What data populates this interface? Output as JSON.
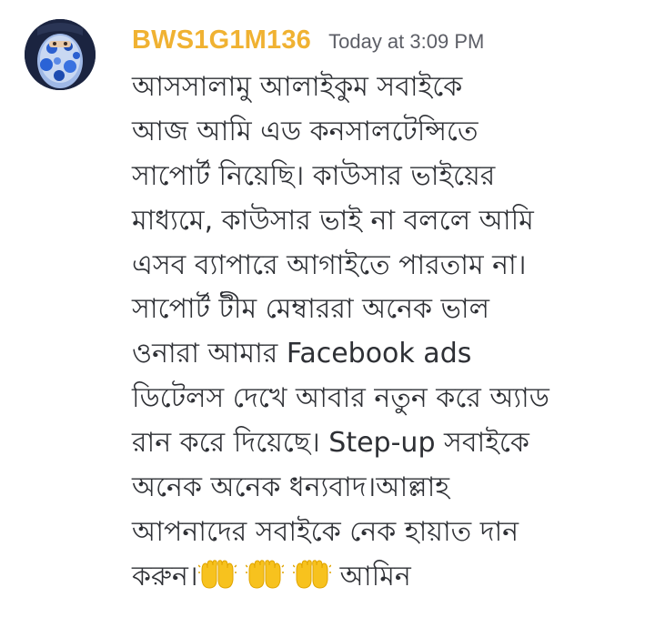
{
  "message": {
    "author": "BWS1G1M136",
    "timestamp": "Today at 3:09 PM",
    "author_color": "#f0b232",
    "lines": [
      "আসসালামু আলাইকুম সবাইকে",
      "আজ আমি এড কনসালটেন্সিতে",
      "সাপোর্ট নিয়েছি। কাউসার ভাইয়ের",
      "মাধ্যমে, কাউসার ভাই না বললে আমি",
      "এসব ব্যাপারে আগাইতে পারতাম না।",
      "সাপোর্ট টীম মেম্বাররা অনেক ভাল",
      "ওনারা আমার  Facebook ads",
      "ডিটেলস দেখে আবার নতুন করে অ্যাড",
      "রান করে দিয়েছে।  Step-up সবাইকে",
      "অনেক অনেক ধন্যবাদ।আল্লাহ",
      "আপনাদের সবাইকে নেক হায়াত দান"
    ],
    "last_line_prefix": "করুন।",
    "emoji_name": "raising-hands-icon",
    "emoji_count": 3,
    "last_line_suffix": "আমিন"
  }
}
